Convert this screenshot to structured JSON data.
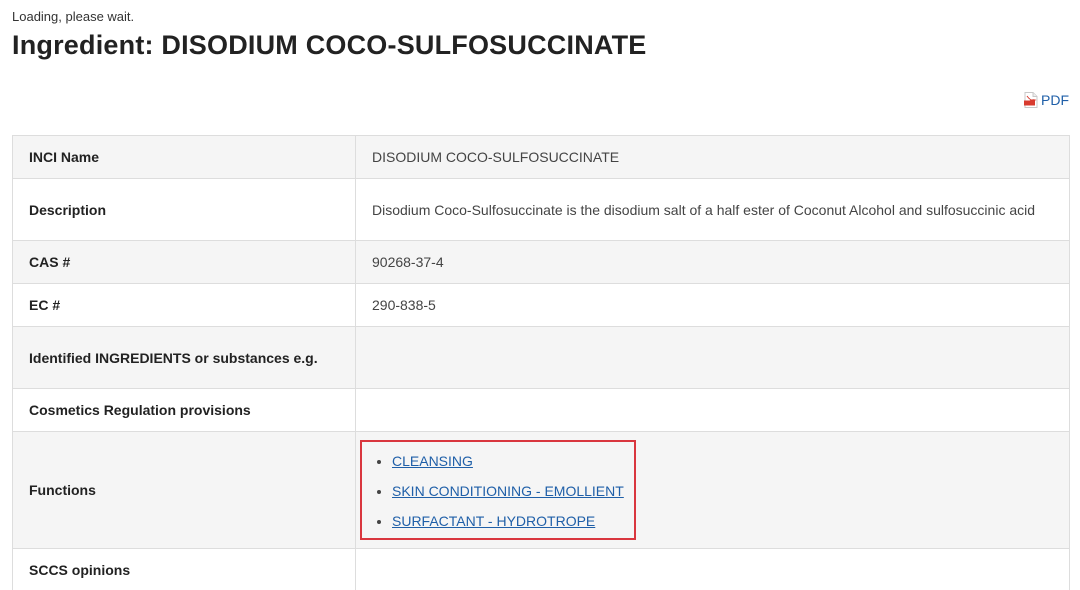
{
  "status": {
    "loading_text": "Loading, please wait."
  },
  "header": {
    "title": "Ingredient: DISODIUM COCO-SULFOSUCCINATE"
  },
  "actions": {
    "pdf_label": "PDF",
    "pdf_icon": "pdf-file-icon"
  },
  "details": {
    "rows": [
      {
        "label": "INCI Name",
        "value": "DISODIUM COCO-SULFOSUCCINATE"
      },
      {
        "label": "Description",
        "value": "Disodium Coco-Sulfosuccinate is the disodium salt of a half ester of Coconut Alcohol and sulfosuccinic acid"
      },
      {
        "label": "CAS #",
        "value": "90268-37-4"
      },
      {
        "label": "EC #",
        "value": "290-838-5"
      },
      {
        "label": "Identified INGREDIENTS or substances e.g.",
        "value": ""
      },
      {
        "label": "Cosmetics Regulation provisions",
        "value": ""
      },
      {
        "label": "Functions",
        "value": ""
      },
      {
        "label": "SCCS opinions",
        "value": ""
      }
    ],
    "functions": [
      "CLEANSING",
      "SKIN CONDITIONING - EMOLLIENT",
      "SURFACTANT - HYDROTROPE"
    ]
  },
  "colors": {
    "link": "#1f5fa8",
    "highlight_border": "#d9363e",
    "row_alt": "#f5f5f5",
    "border": "#dddddd"
  }
}
